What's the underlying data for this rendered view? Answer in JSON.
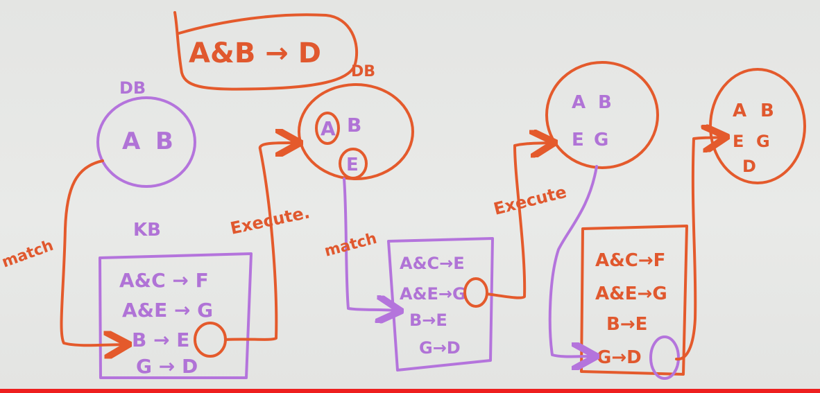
{
  "goal": {
    "text": "A&B → D",
    "label": "DB"
  },
  "stage1": {
    "db_label": "DB",
    "db_facts": [
      "A",
      "B"
    ],
    "kb_label": "KB",
    "rules": [
      "A&C → F",
      "A&E → G",
      "B → E",
      "G → D"
    ],
    "fired": "E"
  },
  "arrows": {
    "match_1": "match",
    "execute_1": "Execute.",
    "match_2": "match",
    "execute_2": "Execute"
  },
  "stage2": {
    "db_facts": [
      "A",
      "B",
      "E"
    ],
    "rules": [
      "A&C→E",
      "A&E→G",
      "B→E",
      "G→D"
    ],
    "fired": "G"
  },
  "stage3": {
    "db_facts": [
      "A",
      "B",
      "E",
      "G"
    ],
    "rules": [
      "A&C→F",
      "A&E→G",
      "B→E",
      "G→D"
    ],
    "fired": "D"
  },
  "stage4": {
    "db_facts": [
      "A",
      "B",
      "E",
      "G",
      "D"
    ]
  },
  "colors": {
    "orange": "#e45a2c",
    "purple": "#b474dc",
    "video_bar": "#ee1f1f"
  }
}
